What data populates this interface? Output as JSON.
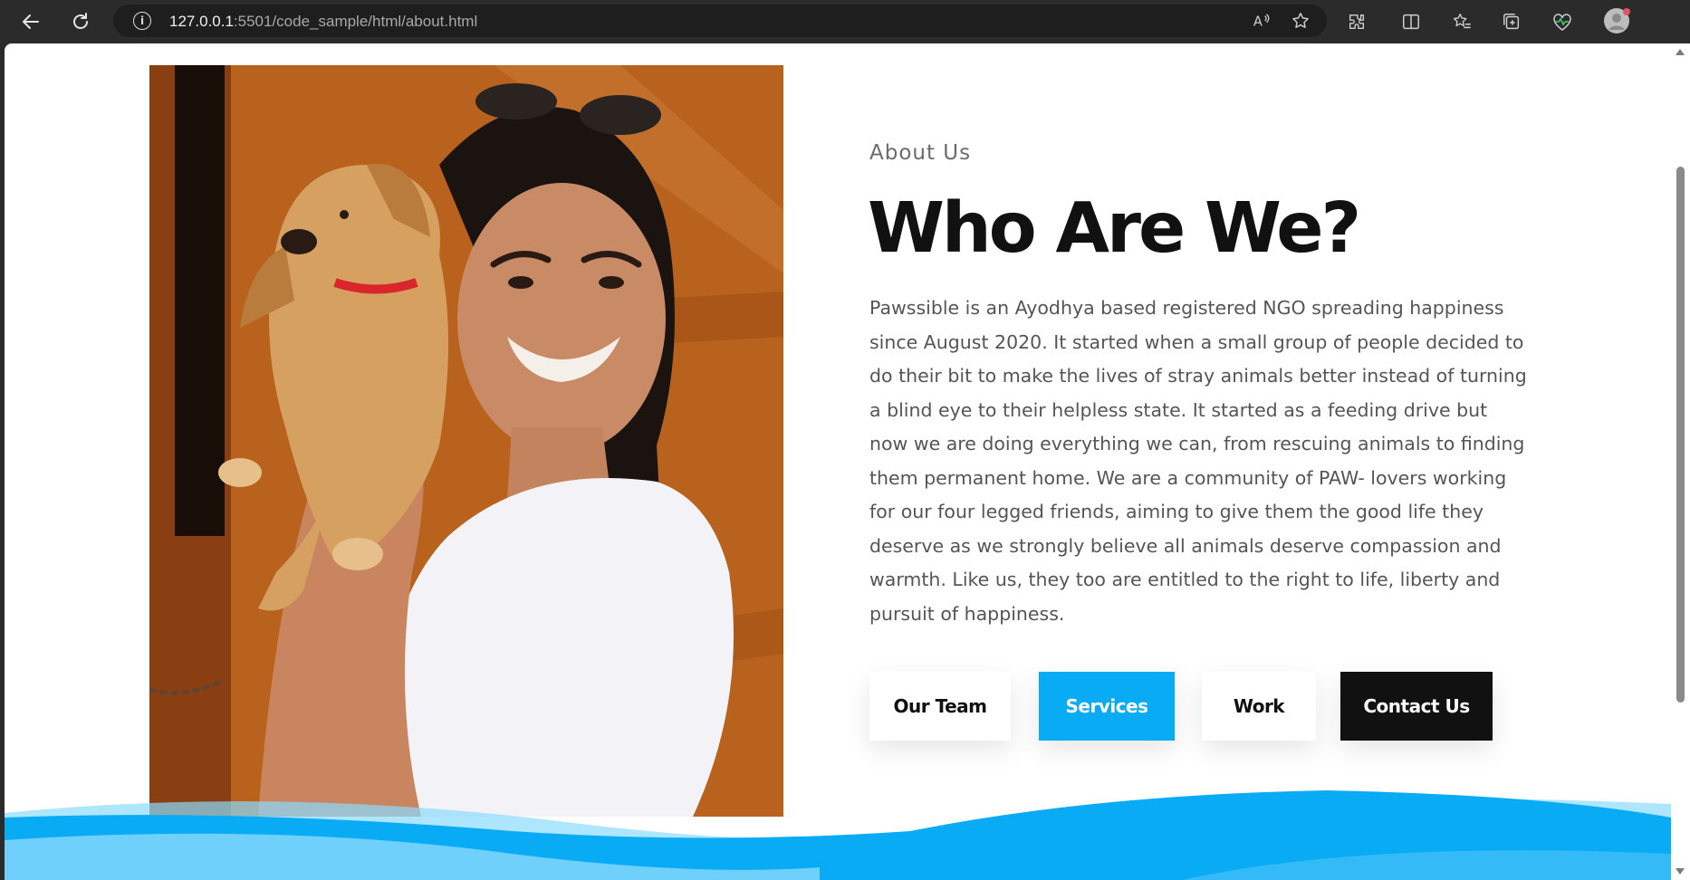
{
  "browser": {
    "url_host": "127.0.0.1",
    "url_rest": ":5501/code_sample/html/about.html"
  },
  "about": {
    "eyebrow": "About Us",
    "heading": "Who Are We?",
    "paragraph": "Pawssible is an Ayodhya based registered NGO spreading happiness since August 2020. It started when a small group of people decided to do their bit to make the lives of stray animals better instead of turning a blind eye to their helpless state. It started as a feeding drive but now we are doing everything we can, from rescuing animals to finding them permanent home. We are a community of PAW- lovers working for our four legged friends, aiming to give them the good life they deserve as we strongly believe all animals deserve compassion and warmth. Like us, they too are entitled to the right to life, liberty and pursuit of happiness.",
    "buttons": {
      "our_team": "Our Team",
      "services": "Services",
      "work": "Work",
      "contact_us": "Contact Us"
    }
  },
  "colors": {
    "accent": "#0aabf5",
    "dark": "#111111",
    "wave_light": "#6fd0fb"
  }
}
